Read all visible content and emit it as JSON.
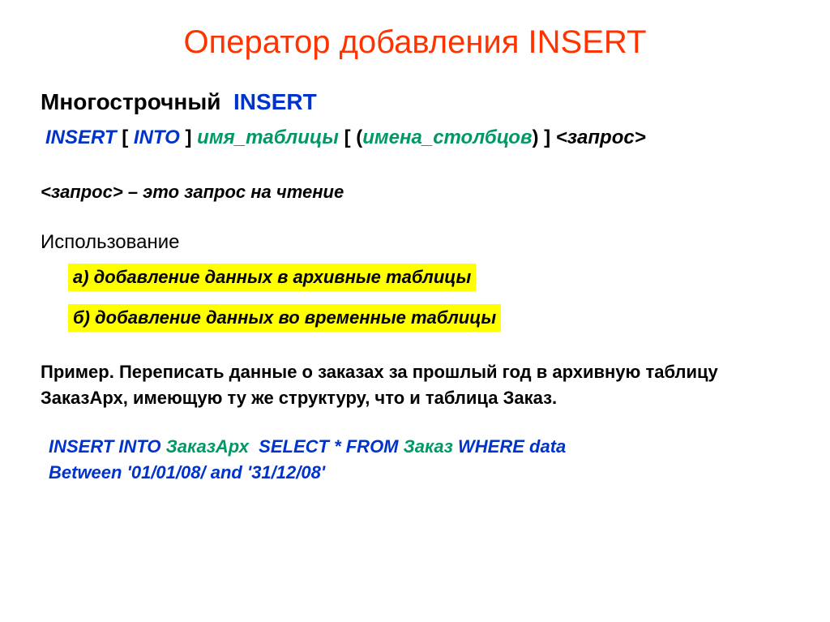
{
  "title": "Оператор добавления INSERT",
  "subtitle": {
    "black": "Многострочный",
    "blue": "INSERT"
  },
  "syntax": {
    "insert": "INSERT",
    "lb1": "[",
    "into": "INTO",
    "rb1": "]",
    "table_var": "имя_таблицы",
    "lb2": "[",
    "lp": "(",
    "cols_var": "имена_столбцов",
    "rp": ")",
    "rb2": "]",
    "request": "<запрос>"
  },
  "definition": "<запрос> – это запрос на чтение",
  "usage_heading": "Использование",
  "usage_a": "а) добавление данных в архивные таблицы",
  "usage_b": "б) добавление данных во временные таблицы",
  "example_text": "Пример. Переписать данные о заказах за прошлый год в архивную таблицу ЗаказАрх, имеющую ту же структуру, что и таблица Заказ.",
  "sql": {
    "insert_into": "INSERT INTO",
    "t1": "ЗаказАрх",
    "select_from": "SELECT * FROM",
    "t2": "Заказ",
    "where": "WHERE",
    "tail1": "data",
    "between": "Between",
    "d1": "'01/01/08/",
    "and": "and",
    "d2": "'31/12/08'"
  }
}
